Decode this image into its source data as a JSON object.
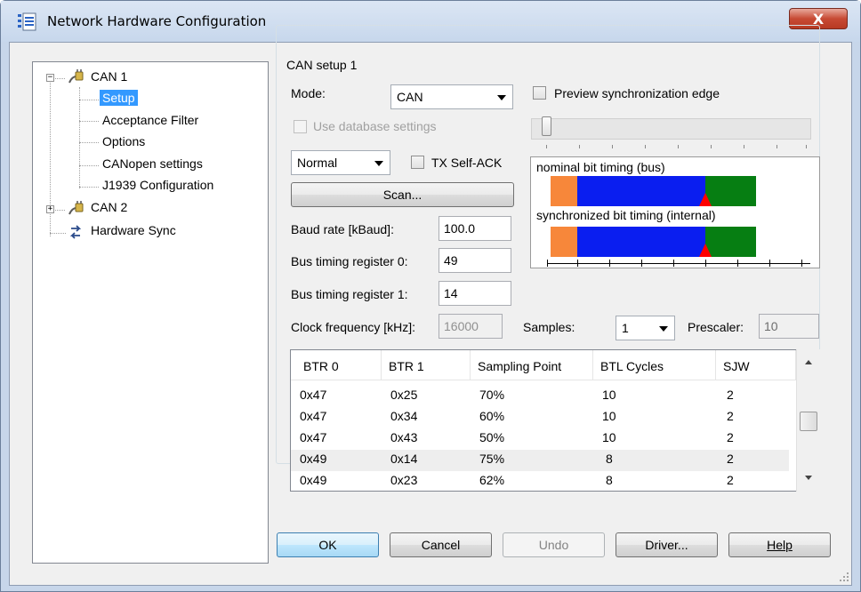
{
  "window": {
    "title": "Network Hardware Configuration",
    "close_label": "X",
    "icon": "network-config-icon"
  },
  "tree": {
    "can1": "CAN 1",
    "setup": "Setup",
    "acceptance_filter": "Acceptance Filter",
    "options": "Options",
    "canopen_settings": "CANopen settings",
    "j1939": "J1939 Configuration",
    "can2": "CAN 2",
    "hardware_sync": "Hardware Sync",
    "expanded_sign": "−",
    "collapsed_sign": "+"
  },
  "setup": {
    "group_title": "CAN setup 1",
    "mode_label": "Mode:",
    "mode_value": "CAN",
    "use_db_label": "Use database settings",
    "preview_sync_label": "Preview synchronization edge",
    "op_mode_value": "Normal",
    "tx_self_ack_label": "TX Self-ACK",
    "scan_label": "Scan...",
    "baud_label": "Baud rate [kBaud]:",
    "baud_value": "100.0",
    "btr0_label": "Bus timing register 0:",
    "btr0_value": "49",
    "btr1_label": "Bus timing register 1:",
    "btr1_value": "14",
    "clock_label": "Clock frequency [kHz]:",
    "clock_value": "16000",
    "samples_label": "Samples:",
    "samples_value": "1",
    "prescaler_label": "Prescaler:",
    "prescaler_value": "10",
    "nominal_label": "nominal bit timing (bus)",
    "sync_label": "synchronized bit timing (internal)",
    "colors": {
      "sync_seg": "#f7873a",
      "tseg1": "#0a1ef0",
      "tseg2": "#067e12",
      "sample_marker": "#ff0000"
    }
  },
  "table": {
    "headers": [
      "BTR 0",
      "BTR 1",
      "Sampling Point",
      "BTL Cycles",
      "SJW"
    ],
    "rows": [
      [
        "0x47",
        "0x25",
        "70%",
        "10",
        "2"
      ],
      [
        "0x47",
        "0x34",
        "60%",
        "10",
        "2"
      ],
      [
        "0x47",
        "0x43",
        "50%",
        "10",
        "2"
      ],
      [
        "0x49",
        "0x14",
        "75%",
        "8",
        "2"
      ],
      [
        "0x49",
        "0x23",
        "62%",
        "8",
        "2"
      ]
    ],
    "selected_row": 3
  },
  "buttons": {
    "ok": "OK",
    "cancel": "Cancel",
    "undo": "Undo",
    "driver": "Driver...",
    "help": "Help"
  }
}
